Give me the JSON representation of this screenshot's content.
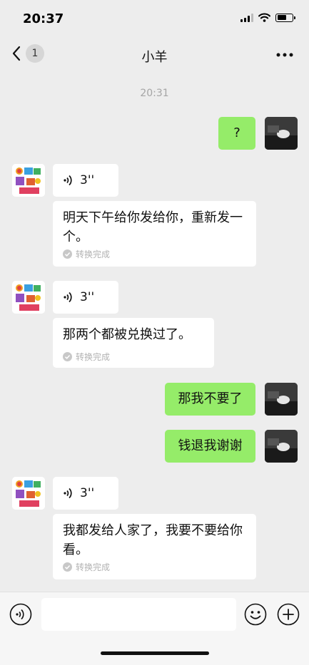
{
  "status_bar": {
    "time": "20:37"
  },
  "nav": {
    "back_badge": "1",
    "title": "小羊"
  },
  "chat": {
    "timestamp": "20:31",
    "messages": [
      {
        "text": "?"
      },
      {
        "duration": "3''",
        "transcript": "明天下午给你发给你，重新发一个。",
        "status": "转换完成"
      },
      {
        "duration": "3''",
        "transcript": "那两个都被兑换过了。",
        "status": "转换完成"
      },
      {
        "text": "那我不要了"
      },
      {
        "text": "钱退我谢谢"
      },
      {
        "duration": "3''",
        "transcript": "我都发给人家了，我要不要给你看。",
        "status": "转换完成"
      }
    ]
  },
  "colors": {
    "outgoing_bubble": "#95ec69",
    "incoming_bubble": "#ffffff",
    "background": "#ededed"
  },
  "icons": [
    "back-icon",
    "more-icon",
    "voice-wave-icon",
    "check-icon",
    "voice-input-icon",
    "emoji-icon",
    "add-icon"
  ]
}
